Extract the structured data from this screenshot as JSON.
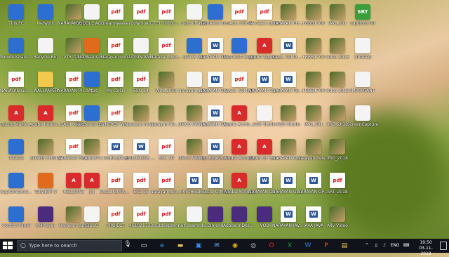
{
  "desktop": {
    "columns": [
      {
        "items": [
          {
            "label": "This PC",
            "type": "app",
            "icon": "computer-icon"
          },
          {
            "label": "Wondershare Filmora",
            "type": "app",
            "icon": "filmora-icon"
          },
          {
            "label": "NARAYAN GUHA",
            "type": "pdf",
            "icon": "pdf-icon"
          },
          {
            "label": "Typing Master 10",
            "type": "red",
            "icon": "typing-master-icon"
          },
          {
            "label": "Telecet",
            "type": "app",
            "icon": "app-icon"
          },
          {
            "label": "SupremeAnd...",
            "type": "app",
            "icon": "app-icon"
          },
          {
            "label": "Control Panel",
            "type": "app",
            "icon": "control-panel-icon"
          }
        ]
      },
      {
        "items": [
          {
            "label": "Network",
            "type": "app",
            "icon": "network-icon"
          },
          {
            "label": "Recycle Bin",
            "type": "white",
            "icon": "recycle-bin-icon"
          },
          {
            "label": "WALLPAPER",
            "type": "folder",
            "icon": "folder-icon"
          },
          {
            "label": "Adobe Reader X",
            "type": "red",
            "icon": "adobe-reader-icon"
          },
          {
            "label": "SONGS PHOTO",
            "type": "img",
            "icon": "image-icon"
          },
          {
            "label": "Tally.ERP 9",
            "type": "orange",
            "icon": "tally-icon"
          },
          {
            "label": "KMPlayer",
            "type": "purple",
            "icon": "kmplayer-icon"
          }
        ]
      },
      {
        "items": [
          {
            "label": "NARAYAN PHOTO",
            "type": "img",
            "icon": "image-icon"
          },
          {
            "label": "VT5_01_0",
            "type": "img",
            "icon": "image-icon"
          },
          {
            "label": "NARAYAN PHOTO",
            "type": "pdf",
            "icon": "pdf-icon"
          },
          {
            "label": "SALIL KUM...",
            "type": "pdf",
            "icon": "pdf-icon"
          },
          {
            "label": "NARAYAN PHOTO 1",
            "type": "pdf",
            "icon": "pdf-icon"
          },
          {
            "label": "HELLOW3",
            "type": "red",
            "icon": "app-icon"
          },
          {
            "label": "Narayan guha",
            "type": "img",
            "icon": "image-icon"
          }
        ]
      },
      {
        "items": [
          {
            "label": "GOOGLE ADSENSE",
            "type": "white",
            "icon": "document-icon"
          },
          {
            "label": "NetBeans 8.2",
            "type": "orange",
            "icon": "netbeans-icon"
          },
          {
            "label": "https",
            "type": "app",
            "icon": "chrome-icon"
          },
          {
            "label": "NetBeans IDE 8.1",
            "type": "app",
            "icon": "netbeans-icon"
          },
          {
            "label": "PARROT1",
            "type": "img",
            "icon": "image-icon"
          },
          {
            "label": "jio",
            "type": "red",
            "icon": "jio-icon"
          },
          {
            "label": "CISCO",
            "type": "white",
            "icon": "document-icon"
          }
        ]
      },
      {
        "items": [
          {
            "label": "Dreamweaver",
            "type": "pdf",
            "icon": "pdf-icon"
          },
          {
            "label": "Narayan guha",
            "type": "pdf",
            "icon": "pdf-icon"
          },
          {
            "label": "My CV(1)",
            "type": "pdf",
            "icon": "pdf-icon"
          },
          {
            "label": "SYNERGY WIPRO",
            "type": "pdf",
            "icon": "pdf-icon"
          },
          {
            "label": "MOBILE/CAP",
            "type": "doc",
            "icon": "word-icon"
          },
          {
            "label": "SALIL KUMAR G...",
            "type": "pdf",
            "icon": "pdf-icon"
          },
          {
            "label": "PROJECT",
            "type": "pdf",
            "icon": "pdf-icon"
          }
        ]
      },
      {
        "items": [
          {
            "label": "download",
            "type": "pdf",
            "icon": "pdf-icon"
          },
          {
            "label": "LOGIN AND",
            "type": "white",
            "icon": "document-icon"
          },
          {
            "label": "ESO 14",
            "type": "pdf",
            "icon": "pdf-icon"
          },
          {
            "label": "Narayan new photo",
            "type": "img",
            "icon": "image-icon"
          },
          {
            "label": "ESILONLINE CLEARANCE",
            "type": "doc",
            "icon": "word-icon"
          },
          {
            "label": "ESZ 15",
            "type": "pdf",
            "icon": "pdf-icon"
          },
          {
            "label": "461021733",
            "type": "pdf",
            "icon": "pdf-icon"
          }
        ]
      },
      {
        "items": [
          {
            "label": "CTET 2018 the exam",
            "type": "pdf",
            "icon": "pdf-icon"
          },
          {
            "label": "Narayan guha result",
            "type": "pdf",
            "icon": "pdf-icon"
          },
          {
            "label": "WIN_2018",
            "type": "img",
            "icon": "image-icon"
          },
          {
            "label": "Narayan New video",
            "type": "img",
            "icon": "video-icon"
          },
          {
            "label": "SSC 10",
            "type": "pdf",
            "icon": "pdf-icon"
          },
          {
            "label": "Narayan guha...",
            "type": "pdf",
            "icon": "pdf-icon"
          },
          {
            "label": "bubbleprem",
            "type": "pdf",
            "icon": "pdf-icon"
          }
        ]
      },
      {
        "items": [
          {
            "label": "Sign off trial",
            "type": "white",
            "icon": "document-icon"
          },
          {
            "label": "DMCS WLT",
            "type": "app",
            "icon": "app-icon"
          },
          {
            "label": "Narayan guha resume",
            "type": "white",
            "icon": "document-icon"
          },
          {
            "label": "DMCS WLT UNDERS...",
            "type": "img",
            "icon": "image-icon"
          },
          {
            "label": "DMCS WLT UNDERS...",
            "type": "img",
            "icon": "image-icon"
          },
          {
            "label": "PAYCHECK I...",
            "type": "doc",
            "icon": "word-icon"
          },
          {
            "label": "net beans de Shortcut",
            "type": "white",
            "icon": "document-icon"
          }
        ]
      },
      {
        "items": [
          {
            "label": "NetBeans IDE 8.1",
            "type": "app",
            "icon": "netbeans-icon"
          },
          {
            "label": "NARAYAN GUHA",
            "type": "doc",
            "icon": "word-icon"
          },
          {
            "label": "NARAYAN GUHA",
            "type": "doc",
            "icon": "word-icon"
          },
          {
            "label": "NARAYAN GUHA",
            "type": "doc",
            "icon": "word-icon"
          },
          {
            "label": "NET BEANS PROJECT",
            "type": "doc",
            "icon": "word-icon"
          },
          {
            "label": "SALIL KUMAR",
            "type": "doc",
            "icon": "word-icon"
          },
          {
            "label": "Dimond",
            "type": "purple",
            "icon": "indesign-icon"
          }
        ]
      },
      {
        "items": [
          {
            "label": "SALIL GUHA",
            "type": "pdf",
            "icon": "pdf-icon"
          },
          {
            "label": "Microsoft Edge",
            "type": "app",
            "icon": "edge-icon"
          },
          {
            "label": "SALIL KUMAR",
            "type": "pdf",
            "icon": "pdf-icon"
          },
          {
            "label": "Adobe Acrobat DC",
            "type": "red",
            "icon": "acrobat-icon"
          },
          {
            "label": "Adobe Acrobat",
            "type": "red",
            "icon": "acrobat-icon"
          },
          {
            "label": "Adobe Acrobat",
            "type": "red",
            "icon": "acrobat-icon"
          },
          {
            "label": "Adobe InDesign",
            "type": "purple",
            "icon": "indesign-icon"
          }
        ]
      },
      {
        "items": [
          {
            "label": "Narayan guha",
            "type": "pdf",
            "icon": "pdf-icon"
          },
          {
            "label": "Adobe Applicati...",
            "type": "red",
            "icon": "adobe-icon"
          },
          {
            "label": "NARAYAN GUHA",
            "type": "doc",
            "icon": "word-icon"
          },
          {
            "label": "OBS Studio",
            "type": "white",
            "icon": "obs-icon"
          },
          {
            "label": "IDEAS OF BANKING",
            "type": "red",
            "icon": "adobe-icon"
          },
          {
            "label": "NARAYAN GUHA",
            "type": "doc",
            "icon": "word-icon"
          },
          {
            "label": "VOB",
            "type": "purple",
            "icon": "video-icon"
          }
        ]
      },
      {
        "items": [
          {
            "label": "NARAYAN PHOTO",
            "type": "img",
            "icon": "image-icon"
          },
          {
            "label": "SALIL KUMAR OPERATING",
            "type": "doc",
            "icon": "word-icon"
          },
          {
            "label": "NARAYAN RESUME",
            "type": "doc",
            "icon": "word-icon"
          },
          {
            "label": "OBS Studio",
            "type": "img",
            "icon": "image-icon"
          },
          {
            "label": "NARAYAN CERTIFICATE",
            "type": "img",
            "icon": "image-icon"
          },
          {
            "label": "NARAYAN GUHA",
            "type": "doc",
            "icon": "word-icon"
          },
          {
            "label": "NARAYAN JAVA 3D",
            "type": "doc",
            "icon": "word-icon"
          }
        ]
      },
      {
        "items": [
          {
            "label": "FBBB1700",
            "type": "img",
            "icon": "image-icon"
          },
          {
            "label": "FBBB1700",
            "type": "img",
            "icon": "image-icon"
          },
          {
            "label": "FBBB1700",
            "type": "img",
            "icon": "image-icon"
          },
          {
            "label": "IMG_201",
            "type": "img",
            "icon": "image-icon"
          },
          {
            "label": "Narayan new photo",
            "type": "img",
            "icon": "image-icon"
          },
          {
            "label": "NARAYAN OPERATING",
            "type": "doc",
            "icon": "word-icon"
          },
          {
            "label": "JAVA JAVA",
            "type": "doc",
            "icon": "word-icon"
          }
        ]
      },
      {
        "items": [
          {
            "label": "IMG_201",
            "type": "img",
            "icon": "image-icon"
          },
          {
            "label": "video 2015",
            "type": "img",
            "icon": "image-icon"
          },
          {
            "label": "video 2018",
            "type": "img",
            "icon": "image-icon"
          },
          {
            "label": "IMG_2018",
            "type": "img",
            "icon": "image-icon"
          },
          {
            "label": "IMG_2018",
            "type": "img",
            "icon": "image-icon"
          },
          {
            "label": "SRT_2018",
            "type": "pdf",
            "icon": "pdf-icon"
          },
          {
            "label": "Ally Video",
            "type": "img",
            "icon": "image-icon"
          }
        ]
      },
      {
        "items": [
          {
            "label": "captions 00",
            "type": "green",
            "icon": "srt-icon"
          },
          {
            "label": "Untitled",
            "type": "white",
            "icon": "document-icon"
          },
          {
            "label": "IMPORTANT",
            "type": "white",
            "icon": "document-icon"
          },
          {
            "label": "ScreenCapture",
            "type": "white",
            "icon": "document-icon"
          },
          {
            "label": "",
            "type": "none",
            "icon": ""
          },
          {
            "label": "",
            "type": "none",
            "icon": ""
          },
          {
            "label": "",
            "type": "none",
            "icon": ""
          }
        ]
      }
    ]
  },
  "taskbar": {
    "search_placeholder": "Type here to search",
    "apps": [
      "task-view-icon",
      "edge-icon",
      "file-explorer-icon",
      "store-icon",
      "mail-icon",
      "chrome-icon",
      "obs-icon",
      "opera-icon",
      "excel-icon",
      "word-icon",
      "powerpoint-icon",
      "explorer-icon"
    ],
    "language": "ENG",
    "time": "19:50",
    "date": "03-11-2018"
  }
}
